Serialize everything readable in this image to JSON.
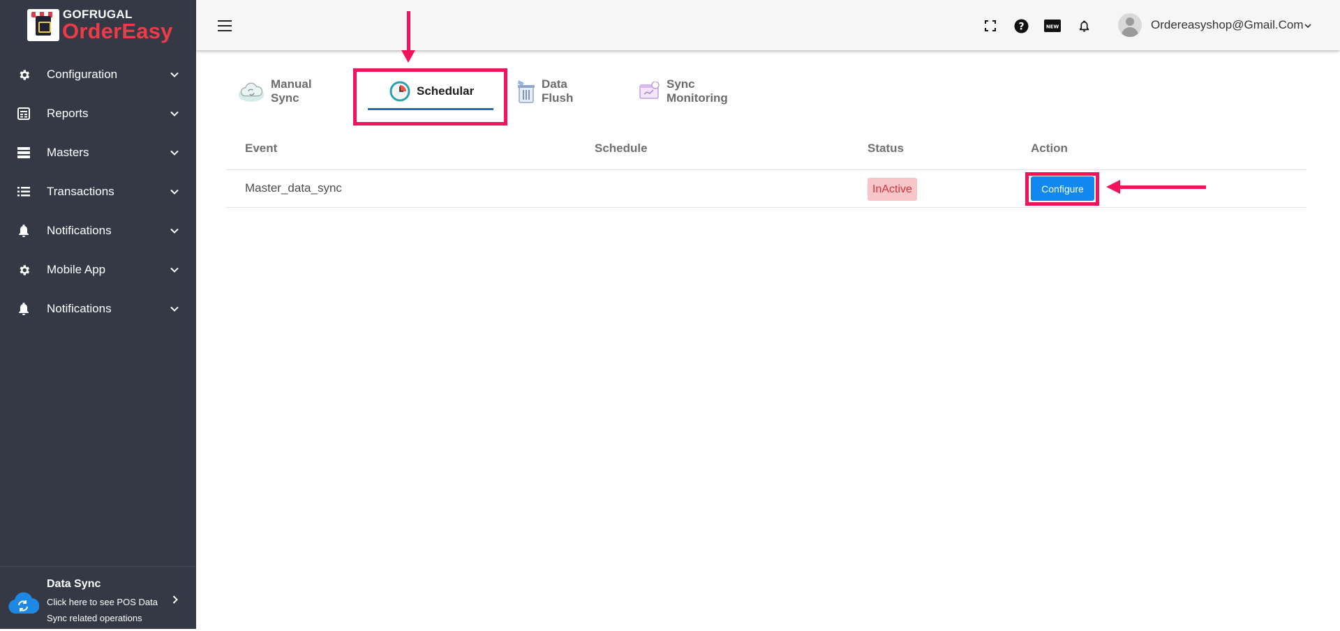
{
  "brand": {
    "top_text": "GOFRUGAL",
    "name": "OrderEasy"
  },
  "sidebar": {
    "items": [
      {
        "label": "Configuration",
        "icon": "gear-icon"
      },
      {
        "label": "Reports",
        "icon": "reports-icon"
      },
      {
        "label": "Masters",
        "icon": "masters-icon"
      },
      {
        "label": "Transactions",
        "icon": "list-icon"
      },
      {
        "label": "Notifications",
        "icon": "bell-icon"
      },
      {
        "label": "Mobile App",
        "icon": "gear-icon"
      },
      {
        "label": "Notifications",
        "icon": "bell-icon"
      }
    ],
    "data_sync": {
      "title": "Data Sync",
      "description": "Click here to see POS Data Sync related operations"
    }
  },
  "header": {
    "icons": [
      "fullscreen-icon",
      "help-icon",
      "new-badge-icon",
      "bell-icon"
    ],
    "user_email": "Ordereasyshop@Gmail.Com"
  },
  "tabs": [
    {
      "label": "Manual Sync",
      "icon": "cloud-sync-icon",
      "active": false
    },
    {
      "label": "Schedular",
      "icon": "clock-icon",
      "active": true
    },
    {
      "label": "Data Flush",
      "icon": "trash-icon",
      "active": false
    },
    {
      "label": "Sync Monitoring",
      "icon": "monitor-icon",
      "active": false
    }
  ],
  "table": {
    "columns": [
      "Event",
      "Schedule",
      "Status",
      "Action"
    ],
    "rows": [
      {
        "event": "Master_data_sync",
        "schedule": "",
        "status": "InActive",
        "action": "Configure"
      }
    ]
  },
  "colors": {
    "sidebar_bg": "#353946",
    "accent_blue": "#1188ee",
    "annotation": "#f0145a",
    "brand_red": "#ef3b47"
  }
}
